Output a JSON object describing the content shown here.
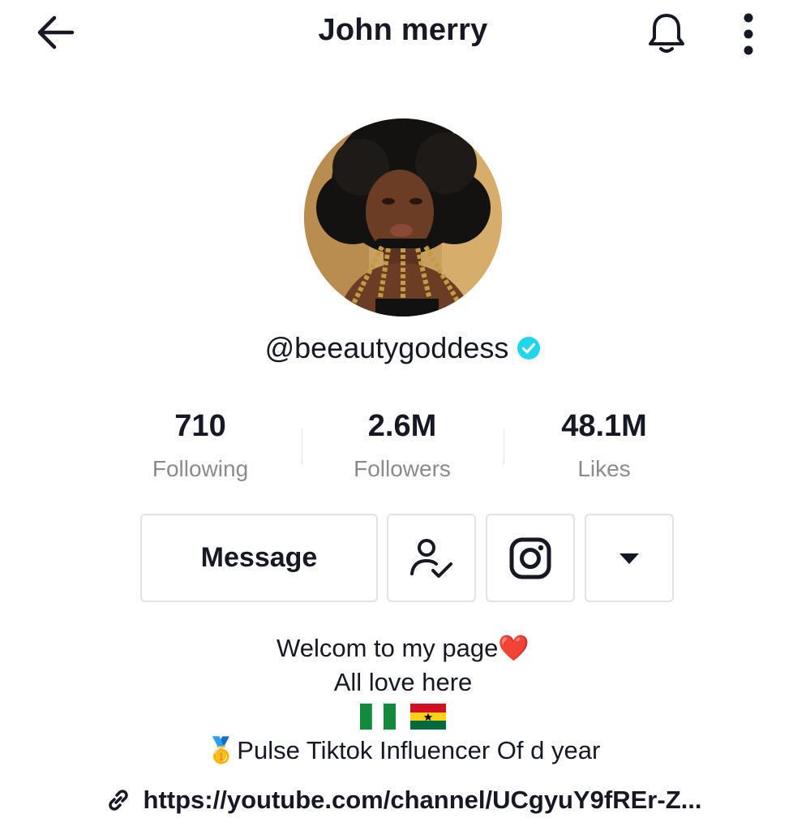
{
  "header": {
    "title": "John merry",
    "back_icon": "arrow-left-icon",
    "bell_icon": "bell-icon",
    "more_icon": "vertical-dots-icon"
  },
  "profile": {
    "handle": "@beeautygoddess",
    "verified": true,
    "verified_color": "#20d5ec"
  },
  "stats": [
    {
      "value": "710",
      "label": "Following"
    },
    {
      "value": "2.6M",
      "label": "Followers"
    },
    {
      "value": "48.1M",
      "label": "Likes"
    }
  ],
  "actions": {
    "message_label": "Message",
    "following_icon": "user-check-icon",
    "instagram_icon": "instagram-icon",
    "dropdown_icon": "caret-down-icon"
  },
  "bio": {
    "line1": "Welcom to my page❤️",
    "line2": "All love here",
    "flags": [
      "Nigeria flag",
      "Ghana flag"
    ],
    "line4": "🥇Pulse Tiktok Influencer Of d year"
  },
  "link": {
    "url": "https://youtube.com/channel/UCgyuY9fREr-Z...",
    "icon": "link-icon"
  }
}
